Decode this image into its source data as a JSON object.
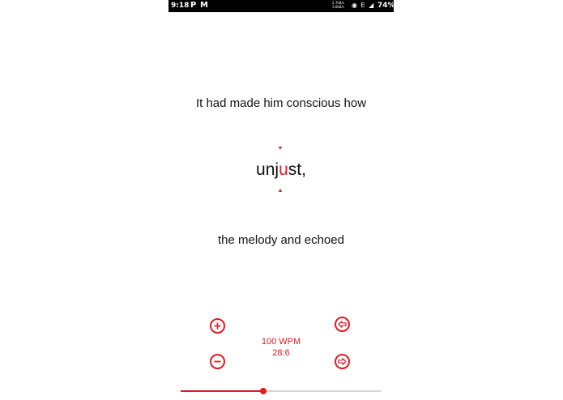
{
  "status_bar": {
    "time": "9:18",
    "app_icon_1": "P",
    "app_icon_2": "M",
    "net_up": "2.7kB/s",
    "net_down": "3.6kB/s",
    "indicators": "◉ E ◢",
    "battery": "74%"
  },
  "reader": {
    "previous_line": "It had made him conscious how",
    "word_before": "unj",
    "word_focus": "u",
    "word_after": "st,",
    "next_line": "the melody and echoed"
  },
  "controls": {
    "wpm": "100 WPM",
    "position": "28:6",
    "progress": 0.41,
    "icons": {
      "increase": "plus-circle-icon",
      "decrease": "minus-circle-icon",
      "back": "arrow-left-circle-icon",
      "forward": "arrow-right-circle-icon"
    }
  },
  "colors": {
    "accent": "#e01b22",
    "text": "#111111",
    "track": "#d6d6d6"
  }
}
